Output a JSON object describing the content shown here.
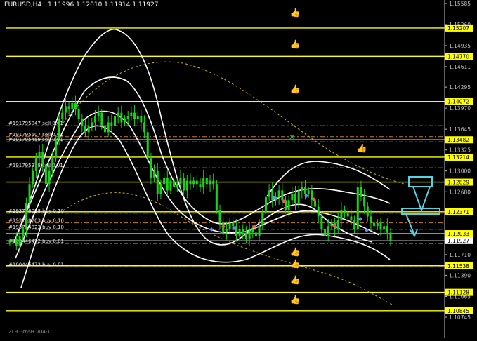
{
  "header": {
    "symbol": "EURUSD,H4",
    "ohlc": "1.11996 1.12010 1.11914 1.11927"
  },
  "footer": {
    "indicator": "ZL9 GrnsH   V04-10"
  },
  "colors": {
    "background": "#000000",
    "candles": "#19d419",
    "level_lines": "#ffff00",
    "bands": "#ffffff",
    "ma_dashed": "#c8b400",
    "order_lines": "#c87a2a",
    "arrow": "#55d3e3",
    "axis_text": "#c0c0c0"
  },
  "price_axis": {
    "ticks": [
      "1.15585",
      "1.15260",
      "1.14935",
      "1.14611",
      "1.14295",
      "1.13970",
      "1.13645",
      "1.13325",
      "1.13000",
      "1.12680",
      "1.12355",
      "1.12030",
      "1.11710",
      "1.11390",
      "1.11065",
      "1.10745"
    ],
    "highlighted": [
      "1.15207",
      "1.14770",
      "1.14072",
      "1.13482",
      "1.13214",
      "1.12829",
      "1.12371",
      "1.12033",
      "1.11927",
      "1.11538",
      "1.11128",
      "1.10845"
    ]
  },
  "levels": [
    "1.15207",
    "1.14770",
    "1.14072",
    "1.13482",
    "1.13214",
    "1.12829",
    "1.12371",
    "1.12033",
    "1.11538",
    "1.11128",
    "1.10845"
  ],
  "current_price": "1.11927",
  "orders": [
    {
      "label": "#191795847 sell 0.01",
      "price": 1.137
    },
    {
      "label": "#191795507 sell 0.01",
      "price": 1.1353
    },
    {
      "label": "#191795459 sell 0.01",
      "price": 1.1345
    },
    {
      "label": "#191795378 sell 0.01",
      "price": 1.1305
    },
    {
      "label": "#193756038 buy 0.10",
      "price": 1.1235
    },
    {
      "label": "#193758763 buy 0.10",
      "price": 1.122
    },
    {
      "label": "#193754823 buy 0.10",
      "price": 1.121
    },
    {
      "label": "#190446472 buy 0.01",
      "price": 1.1188
    },
    {
      "label": "#190446472 buy 0.01",
      "price": 1.1152
    }
  ],
  "thumb_icons": {
    "count": 8,
    "name": "thumbs-up-icon"
  },
  "chart_data": {
    "type": "candlestick",
    "title": "EURUSD,H4",
    "ylim": [
      1.106,
      1.156
    ],
    "close": [
      1.119,
      1.1195,
      1.1185,
      1.12,
      1.121,
      1.125,
      1.128,
      1.13,
      1.132,
      1.133,
      1.131,
      1.128,
      1.13,
      1.132,
      1.135,
      1.138,
      1.139,
      1.14,
      1.1395,
      1.1405,
      1.1395,
      1.138,
      1.137,
      1.136,
      1.137,
      1.1375,
      1.1385,
      1.139,
      1.137,
      1.136,
      1.1375,
      1.137,
      1.1385,
      1.139,
      1.1375,
      1.138,
      1.1385,
      1.139,
      1.138,
      1.1385,
      1.1375,
      1.136,
      1.132,
      1.129,
      1.13,
      1.1265,
      1.128,
      1.129,
      1.127,
      1.1285,
      1.1275,
      1.128,
      1.129,
      1.127,
      1.1285,
      1.128,
      1.1285,
      1.128,
      1.1275,
      1.129,
      1.128,
      1.1285,
      1.128,
      1.124,
      1.122,
      1.1205,
      1.121,
      1.122,
      1.1215,
      1.12,
      1.121,
      1.1205,
      1.1195,
      1.121,
      1.1205,
      1.12,
      1.1215,
      1.1235,
      1.126,
      1.127,
      1.1255,
      1.126,
      1.127,
      1.1255,
      1.124,
      1.1255,
      1.1265,
      1.125,
      1.127,
      1.1275,
      1.1265,
      1.127,
      1.1255,
      1.1245,
      1.123,
      1.121,
      1.12,
      1.1215,
      1.122,
      1.121,
      1.1225,
      1.124,
      1.1235,
      1.123,
      1.1225,
      1.121,
      1.1275,
      1.126,
      1.1245,
      1.123,
      1.122,
      1.1215,
      1.122,
      1.121,
      1.1215,
      1.1205,
      1.1193
    ]
  }
}
